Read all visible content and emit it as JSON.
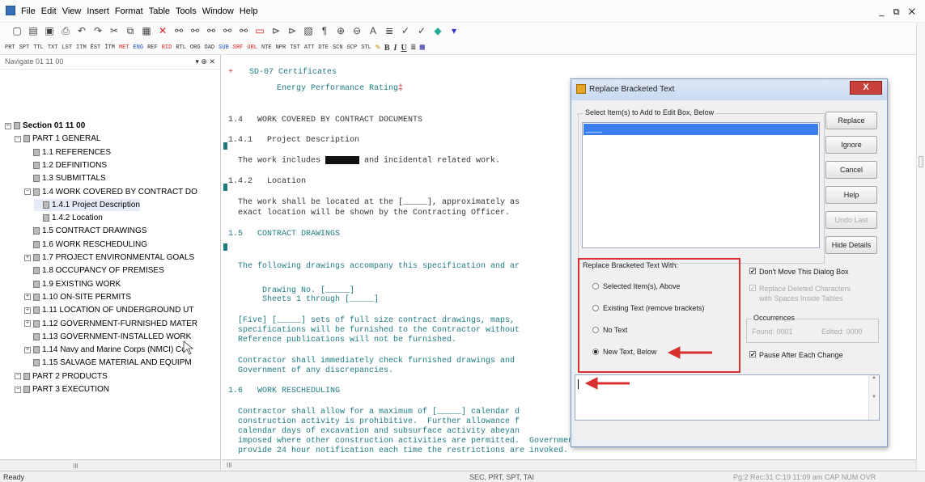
{
  "menubar": {
    "items": [
      "File",
      "Edit",
      "View",
      "Insert",
      "Format",
      "Table",
      "Tools",
      "Window",
      "Help"
    ],
    "window_controls": "_ ⧉ ✕"
  },
  "toolbar2": {
    "codes": [
      "PRT",
      "SPT",
      "TTL",
      "TXT",
      "LST",
      "ITM",
      "ĒST",
      "ĪTM",
      "MET",
      "ENG",
      "REF",
      "RID",
      "RTL",
      "ORG",
      "OAD",
      "SUB",
      "SRF",
      "URL",
      "NTE",
      "NPR",
      "TST",
      "ATT",
      "DTE",
      "SCN",
      "SCP",
      "STL"
    ],
    "format": [
      "B",
      "I",
      "U"
    ]
  },
  "navigator": {
    "title": "Navigate 01 11 00",
    "pin": "▾ ⊕ ✕",
    "tree": [
      {
        "label": "Section 01 11 00",
        "depth": 0,
        "bold": true
      },
      {
        "label": "PART 1  GENERAL",
        "depth": 1
      },
      {
        "label": "1.1  REFERENCES",
        "depth": 2
      },
      {
        "label": "1.2  DEFINITIONS",
        "depth": 2
      },
      {
        "label": "1.3  SUBMITTALS",
        "depth": 2
      },
      {
        "label": "1.4  WORK COVERED BY CONTRACT DO",
        "depth": 2
      },
      {
        "label": "1.4.1  Project Description",
        "depth": 3,
        "selected": true
      },
      {
        "label": "1.4.2  Location",
        "depth": 3
      },
      {
        "label": "1.5  CONTRACT DRAWINGS",
        "depth": 2
      },
      {
        "label": "1.6  WORK RESCHEDULING",
        "depth": 2
      },
      {
        "label": "1.7  PROJECT ENVIRONMENTAL GOALS",
        "depth": 2
      },
      {
        "label": "1.8  OCCUPANCY OF PREMISES",
        "depth": 2
      },
      {
        "label": "1.9  EXISTING WORK",
        "depth": 2
      },
      {
        "label": "1.10  ON-SITE PERMITS",
        "depth": 2
      },
      {
        "label": "1.11  LOCATION OF UNDERGROUND UT",
        "depth": 2
      },
      {
        "label": "1.12  GOVERNMENT-FURNISHED MATER",
        "depth": 2
      },
      {
        "label": "1.13  GOVERNMENT-INSTALLED WORK",
        "depth": 2
      },
      {
        "label": "1.14  Navy and Marine Corps (NMCI) Co",
        "depth": 2
      },
      {
        "label": "1.15  SALVAGE MATERIAL AND EQUIPM",
        "depth": 2
      },
      {
        "label": "PART 2  PRODUCTS",
        "depth": 1
      },
      {
        "label": "PART 3  EXECUTION",
        "depth": 1
      }
    ],
    "hscroll_grip": "III"
  },
  "document": {
    "lines": [
      {
        "text": "+",
        "style": "red"
      },
      {
        "text": "SD-07 Certificates",
        "style": "teal"
      },
      {
        "text": "Energy Performance Rating",
        "style": "teal"
      },
      {
        "text": "1.4   WORK COVERED BY CONTRACT DOCUMENTS",
        "style": ""
      },
      {
        "text": "1.4.1   Project Description",
        "style": ""
      },
      {
        "text": "The work includes ",
        "style": ""
      },
      {
        "text": " and incidental related work.",
        "style": ""
      },
      {
        "text": "1.4.2   Location",
        "style": ""
      },
      {
        "text": "The work shall be located at the [_____], approximately as",
        "style": ""
      },
      {
        "text": "exact location will be shown by the Contracting Officer.",
        "style": ""
      },
      {
        "text": "1.5   CONTRACT DRAWINGS",
        "style": "teal"
      },
      {
        "text": "The following drawings accompany this specification and ar",
        "style": "teal"
      },
      {
        "text": "Drawing No. [_____]",
        "style": "teal"
      },
      {
        "text": "Sheets 1 through [_____]",
        "style": "teal"
      },
      {
        "text": "[Five] [_____] sets of full size contract drawings, maps,",
        "style": "teal"
      },
      {
        "text": "specifications will be furnished to the Contractor without",
        "style": "teal"
      },
      {
        "text": "Reference publications will not be furnished.",
        "style": "teal"
      },
      {
        "text": "Contractor shall immediately check furnished drawings and",
        "style": "teal"
      },
      {
        "text": "Government of any discrepancies.",
        "style": "teal"
      },
      {
        "text": "1.6   WORK RESCHEDULING",
        "style": "teal"
      },
      {
        "text": "Contractor shall allow for a maximum of [_____] calendar d",
        "style": "teal"
      },
      {
        "text": "construction activity is prohibitive.  Further allowance f",
        "style": "teal"
      },
      {
        "text": "calendar days of excavation and subsurface activity abeyan",
        "style": "teal"
      },
      {
        "text": "imposed where other construction activities are permitted.  Government will",
        "style": "teal"
      },
      {
        "text": "provide 24 hour notification each time the restrictions are invoked.",
        "style": "teal"
      }
    ],
    "hscroll_grip": "III"
  },
  "dialog": {
    "title": "Replace Bracketed Text",
    "close": "X",
    "select_label": "Select Item(s) to Add to Edit Box, Below",
    "list_selected": "____",
    "buttons": {
      "replace": "Replace",
      "ignore": "Ignore",
      "cancel": "Cancel",
      "help": "Help",
      "undo": "Undo Last",
      "hide": "Hide Details"
    },
    "replace_with_label": "Replace Bracketed Text With:",
    "radios": {
      "selected_items": "Selected Item(s), Above",
      "existing": "Existing Text (remove brackets)",
      "no_text": "No Text",
      "new_text": "New Text, Below"
    },
    "checks": {
      "dont_move": "Don't Move This Dialog Box",
      "replace_deleted_1": "Replace Deleted Characters",
      "replace_deleted_2": "with Spaces Inside Tables",
      "pause": "Pause After Each Change"
    },
    "checkmark": "✔",
    "occurrences_label": "Occurrences",
    "found": "Found: 0001",
    "edited": "Edited: 0000",
    "edit_value": ""
  },
  "status": {
    "left": "Ready",
    "middle": "SEC, PRT, SPT, TAI",
    "right": "Pg:2 Rec:31 C:19   11:09 am  CAP NUM OVR"
  },
  "colors": {
    "highlight_red": "#d8302e",
    "teal_text": "#1d7a80",
    "selection_blue": "#3a7ef0"
  }
}
